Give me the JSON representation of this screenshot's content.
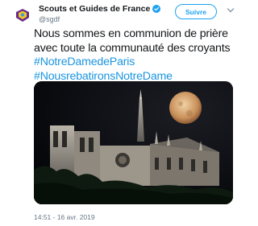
{
  "author": {
    "display_name": "Scouts et Guides de France",
    "handle": "@sgdf",
    "verified": true
  },
  "follow_button": {
    "label": "Suivre"
  },
  "tweet": {
    "lines": [
      "Nous sommes en communion de prière",
      "avec toute la communauté des croyants"
    ],
    "hashtags": [
      "#NotreDamedeParis",
      "#NousrebatironsNotreDame"
    ],
    "timestamp": "14:51 - 16 avr. 2019"
  },
  "media": {
    "icon": "photo-notre-dame-night"
  },
  "colors": {
    "accent": "#1da1f2",
    "hashtag": "#1b95e0",
    "muted": "#657786"
  }
}
